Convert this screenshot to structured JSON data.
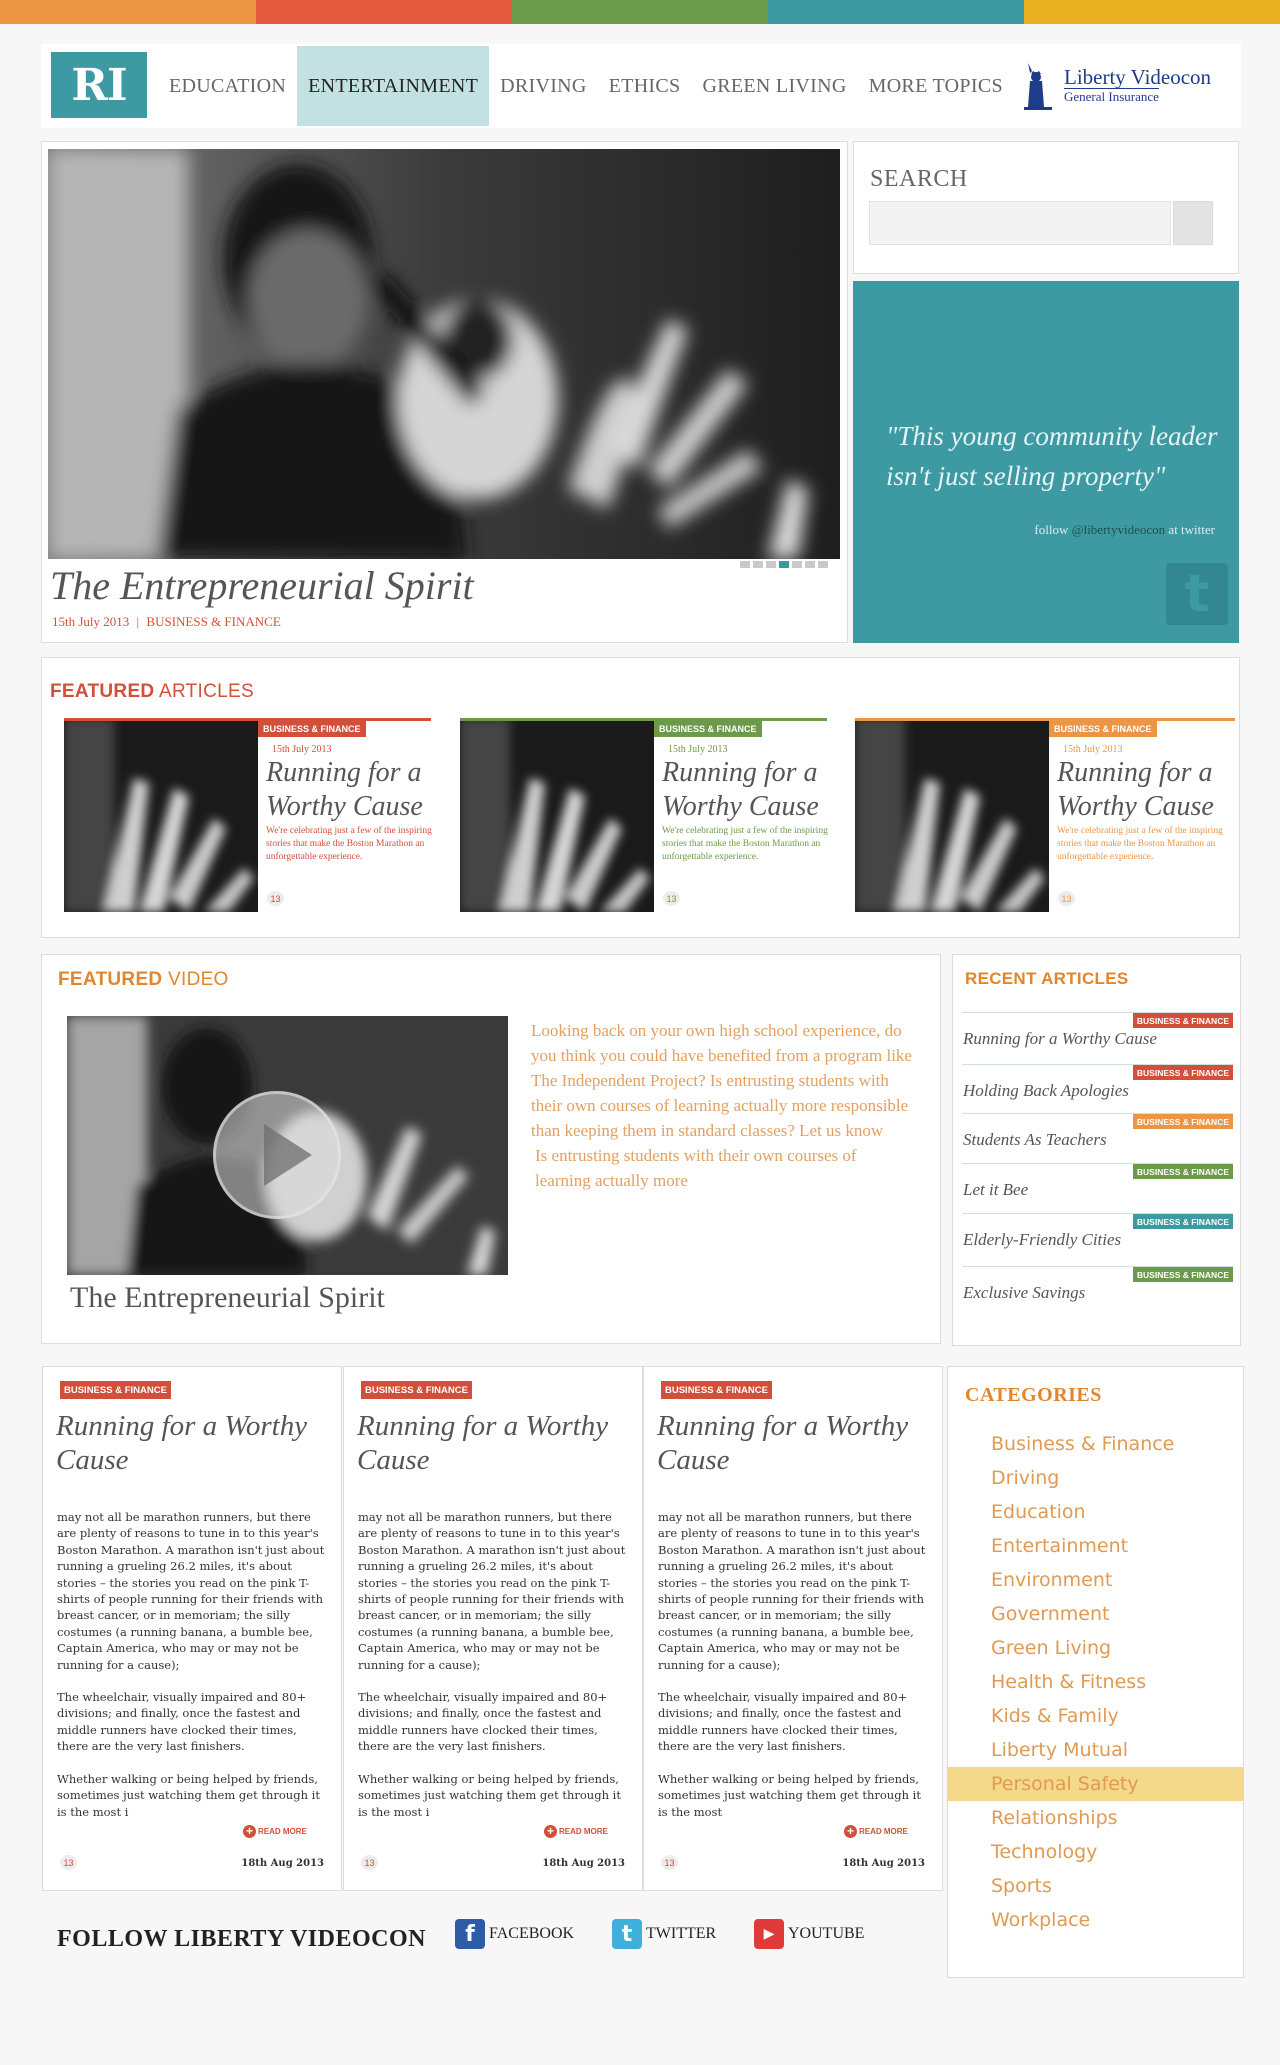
{
  "colors": {
    "top_stripes": [
      "#ec9544",
      "#e55a3e",
      "#6b9a4a",
      "#3d9aa3",
      "#e8b021"
    ],
    "accent_teal": "#3d9aa3",
    "red": "#d24f3a",
    "green": "#6b9a4a",
    "orange": "#e0862c"
  },
  "header": {
    "logo": "RI",
    "nav": [
      {
        "label": "EDUCATION",
        "active": false
      },
      {
        "label": "ENTERTAINMENT",
        "active": true
      },
      {
        "label": "DRIVING",
        "active": false
      },
      {
        "label": "ETHICS",
        "active": false
      },
      {
        "label": "GREEN LIVING",
        "active": false
      },
      {
        "label": "MORE TOPICS",
        "active": false
      }
    ],
    "brand_line1": "Liberty Videocon",
    "brand_line2": "General Insurance"
  },
  "hero": {
    "title": "The Entrepreneurial Spirit",
    "date": "15th July 2013",
    "separator": "|",
    "category": "BUSINESS & FINANCE",
    "slide_count": 7,
    "active_slide": 3
  },
  "search": {
    "label": "SEARCH",
    "placeholder": ""
  },
  "quote": {
    "text": "\"This young community leader isn't just selling property\"",
    "follow_prefix": "follow",
    "handle": "@libertyvideocon",
    "follow_suffix": "at twitter",
    "icon": "twitter-icon"
  },
  "featured": {
    "title_bold": "FEATURED",
    "title_rest": " ARTICLES",
    "cards": [
      {
        "badge": "BUSINESS & FINANCE",
        "date": "15th July 2013",
        "title": "Running for a Worthy Cause",
        "desc": "We're celebrating just a few of the inspiring stories that make the Boston Marathon an unforgettable experience.",
        "count": "13",
        "color": "#d24f3a"
      },
      {
        "badge": "BUSINESS & FINANCE",
        "date": "15th July 2013",
        "title": "Running for a Worthy Cause",
        "desc": "We're celebrating just a few of the inspiring stories that make the Boston Marathon an unforgettable experience.",
        "count": "13",
        "color": "#6b9a4a"
      },
      {
        "badge": "BUSINESS & FINANCE",
        "date": "15th July 2013",
        "title": "Running for a Worthy Cause",
        "desc": "We're celebrating just a few of the inspiring stories that make the Boston Marathon an unforgettable experience.",
        "count": "13",
        "color": "#ec9544"
      }
    ]
  },
  "video": {
    "title_bold": "FEATURED",
    "title_rest": " VIDEO",
    "caption": "The Entrepreneurial Spirit",
    "text1": "Looking back on your own high school experience, do you think you could have benefited from a program like The Independent Project? Is entrusting students with their own courses of learning actually more responsible than keeping them in standard classes? Let us know",
    "text2": "Is entrusting students with their own courses of learning actually more"
  },
  "recent": {
    "title": "RECENT ARTICLES",
    "items": [
      {
        "badge": "BUSINESS & FINANCE",
        "title": "Running for a Worthy Cause",
        "color": "#d24f3a"
      },
      {
        "badge": "BUSINESS & FINANCE",
        "title": "Holding Back Apologies",
        "color": "#d24f3a"
      },
      {
        "badge": "BUSINESS & FINANCE",
        "title": "Students As Teachers",
        "color": "#ec9544"
      },
      {
        "badge": "BUSINESS & FINANCE",
        "title": "Let it Bee",
        "color": "#6b9a4a"
      },
      {
        "badge": "BUSINESS & FINANCE",
        "title": "Elderly-Friendly Cities",
        "color": "#3d9aa3"
      },
      {
        "badge": "BUSINESS & FINANCE",
        "title": "Exclusive Savings",
        "color": "#6b9a4a"
      }
    ]
  },
  "posts": [
    {
      "badge": "BUSINESS & FINANCE",
      "title": "Running for a Worthy Cause",
      "p1": "may not all be marathon runners, but there are plenty of reasons to tune in to this year's Boston Marathon. A marathon isn't just about running a grueling 26.2 miles, it's about stories – the stories you read on the pink T-shirts of people running for their friends with breast cancer, or in memoriam; the silly costumes (a running banana, a bumble bee, Captain America, who may or may not be running for a cause);",
      "p2": "The wheelchair, visually impaired and 80+ divisions; and finally, once the fastest and middle runners have clocked their times, there are the very last finishers.",
      "p3": "Whether walking or being helped by friends, sometimes just watching them get through it is the most i",
      "read_more": "READ MORE",
      "count": "13",
      "date": "18th Aug 2013"
    },
    {
      "badge": "BUSINESS & FINANCE",
      "title": "Running for a Worthy Cause",
      "p1": "may not all be marathon runners, but there are plenty of reasons to tune in to this year's Boston Marathon. A marathon isn't just about running a grueling 26.2 miles, it's about stories – the stories you read on the pink T-shirts of people running for their friends with breast cancer, or in memoriam; the silly costumes (a running banana, a bumble bee, Captain America, who may or may not be running for a cause);",
      "p2": "The wheelchair, visually impaired and 80+ divisions; and finally, once the fastest and middle runners have clocked their times, there are the very last finishers.",
      "p3": "Whether walking or being helped by friends, sometimes just watching them get through it is the most i",
      "read_more": "READ MORE",
      "count": "13",
      "date": "18th Aug 2013"
    },
    {
      "badge": "BUSINESS & FINANCE",
      "title": "Running for a Worthy Cause",
      "p1": "may not all be marathon runners, but there are plenty of reasons to tune in to this year's Boston Marathon. A marathon isn't just about running a grueling 26.2 miles, it's about stories – the stories you read on the pink T-shirts of people running for their friends with breast cancer, or in memoriam; the silly costumes (a running banana, a bumble bee, Captain America, who may or may not be running for a cause);",
      "p2": "The wheelchair, visually impaired and 80+ divisions; and finally, once the fastest and middle runners have clocked their times, there are the very last finishers.",
      "p3": "Whether walking or being helped by friends, sometimes just watching them get through it is the most",
      "read_more": "READ MORE",
      "count": "13",
      "date": "18th Aug 2013"
    }
  ],
  "categories": {
    "title": "CATEGORIES",
    "items": [
      {
        "label": "Business & Finance",
        "highlight": false
      },
      {
        "label": "Driving",
        "highlight": false
      },
      {
        "label": "Education",
        "highlight": false
      },
      {
        "label": "Entertainment",
        "highlight": false
      },
      {
        "label": "Environment",
        "highlight": false
      },
      {
        "label": "Government",
        "highlight": false
      },
      {
        "label": "Green Living",
        "highlight": false
      },
      {
        "label": "Health & Fitness",
        "highlight": false
      },
      {
        "label": "Kids & Family",
        "highlight": false
      },
      {
        "label": "Liberty Mutual",
        "highlight": false
      },
      {
        "label": "Personal Safety",
        "highlight": true
      },
      {
        "label": "Relationships",
        "highlight": false
      },
      {
        "label": "Technology",
        "highlight": false
      },
      {
        "label": "Sports",
        "highlight": false
      },
      {
        "label": "Workplace",
        "highlight": false
      }
    ]
  },
  "follow": {
    "title": "FOLLOW LIBERTY VIDEOCON",
    "links": [
      {
        "label": "FACEBOOK",
        "icon": "facebook-icon",
        "glyph": "f",
        "color": "#2d5ba5"
      },
      {
        "label": "TWITTER",
        "icon": "twitter-icon",
        "glyph": "t",
        "color": "#3fb0da"
      },
      {
        "label": "YOUTUBE",
        "icon": "youtube-icon",
        "glyph": "▶",
        "color": "#e03b3b"
      }
    ]
  }
}
